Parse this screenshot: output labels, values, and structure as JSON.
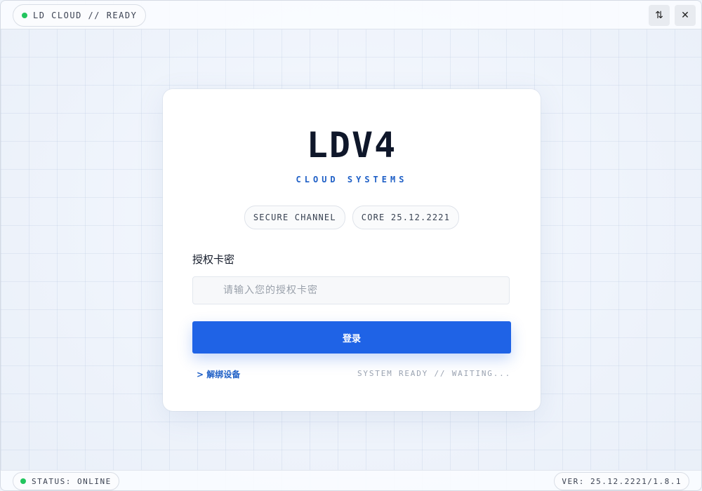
{
  "titlebar": {
    "app_status": "LD CLOUD // READY",
    "status_color": "#22c55e"
  },
  "window_controls": {
    "toggle_icon": "swap-vertical-arrows-icon",
    "close_icon": "close-icon",
    "toggle_glyph": "⇅",
    "close_glyph": "✕"
  },
  "card": {
    "logo": "LDV4",
    "subtitle": "CLOUD SYSTEMS",
    "badges": [
      "SECURE CHANNEL",
      "CORE 25.12.2221"
    ],
    "field_label": "授权卡密",
    "input_placeholder": "请输入您的授权卡密",
    "input_value": "",
    "login_label": "登录",
    "unbind_label": "> 解绑设备",
    "system_status": "SYSTEM READY // WAITING..."
  },
  "statusbar": {
    "status": "STATUS: ONLINE",
    "version": "VER: 25.12.2221/1.8.1"
  },
  "colors": {
    "accent": "#1f63e6",
    "accent_text": "#1e5fc6",
    "online": "#22c55e"
  }
}
